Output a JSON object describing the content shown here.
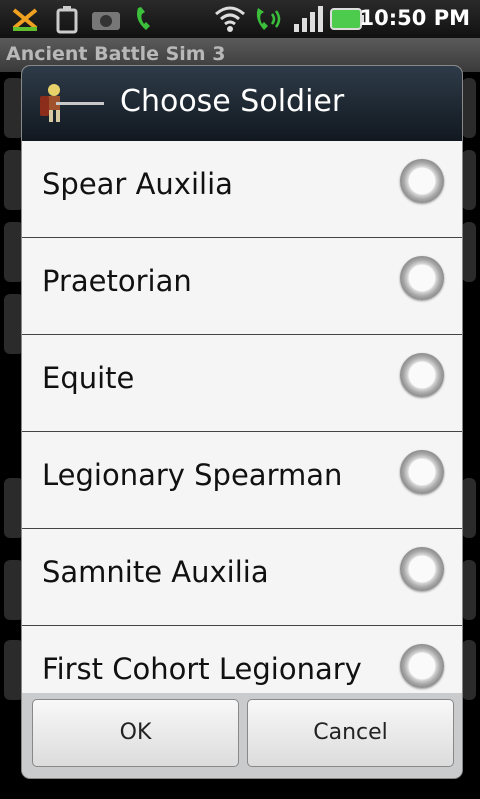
{
  "status_bar": {
    "time": "10:50 PM",
    "icons": [
      "missed-call-icon",
      "battery-saver-icon",
      "camera-icon",
      "phone-icon",
      "wifi-icon",
      "phone-speaker-icon",
      "signal-icon",
      "battery-icon"
    ]
  },
  "app": {
    "title": "Ancient Battle Sim 3"
  },
  "dialog": {
    "title": "Choose Soldier",
    "items": [
      {
        "label": "Spear Auxilia"
      },
      {
        "label": "Praetorian"
      },
      {
        "label": "Equite"
      },
      {
        "label": "Legionary Spearman"
      },
      {
        "label": "Samnite Auxilia"
      },
      {
        "label": "First Cohort Legionary"
      }
    ],
    "buttons": {
      "ok": "OK",
      "cancel": "Cancel"
    }
  }
}
